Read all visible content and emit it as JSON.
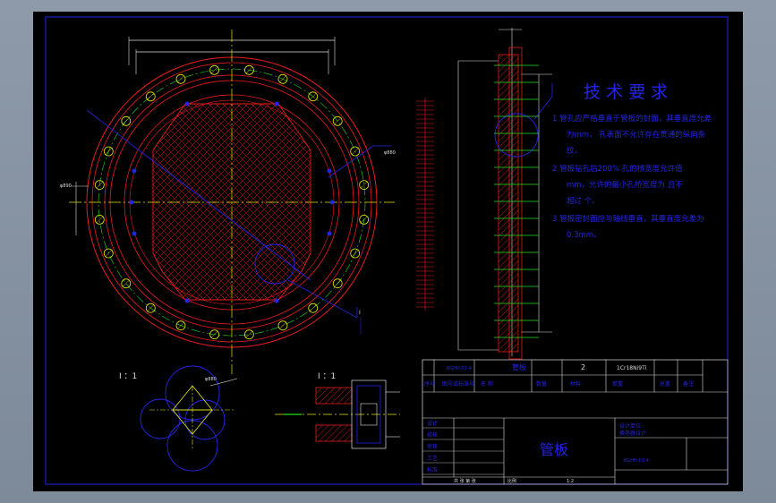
{
  "tech_requirements": {
    "title": "技 术 要 求",
    "items": [
      {
        "num": "1",
        "lines": [
          "管孔应严格垂直于管板的封面，其垂直度允差",
          "为mm， 孔表面不允许存在贯通的纵向条",
          "纹。"
        ]
      },
      {
        "num": "2",
        "lines": [
          "管板钻孔后200%  孔的桥宽度允许值",
          "mm，允许的最小孔桥宽度为   且不",
          "超过  个。"
        ]
      },
      {
        "num": "3",
        "lines": [
          "管板密封面应与轴线垂直，其垂直度允差为",
          "0.3mm。"
        ]
      }
    ]
  },
  "section_labels": {
    "detail_a": "I ：1",
    "detail_b": "I ：1",
    "view_marker": "I"
  },
  "title_block": {
    "part_code": "BGHH-01-4",
    "part_name_small": "管板",
    "quantity": "2",
    "material_spec": "1Cr18Ni9Ti",
    "header_cols": [
      "序号",
      "图号或标准号",
      "名 称",
      "数量",
      "材料",
      "单重",
      "总重",
      "备注"
    ],
    "rows_left": [
      "设计",
      "校核",
      "审核",
      "工艺",
      "标准"
    ],
    "part_name_big": "管板",
    "company_lines": [
      "设计单位",
      "换热器设计"
    ],
    "drawing_no": "BGHH-01-4",
    "scale_label": "比例",
    "scale_value": "1:2",
    "sheet_info": "共  张 第  张"
  },
  "dimension_labels": {
    "left_dim": "φ890",
    "leader_label": "φ880"
  }
}
